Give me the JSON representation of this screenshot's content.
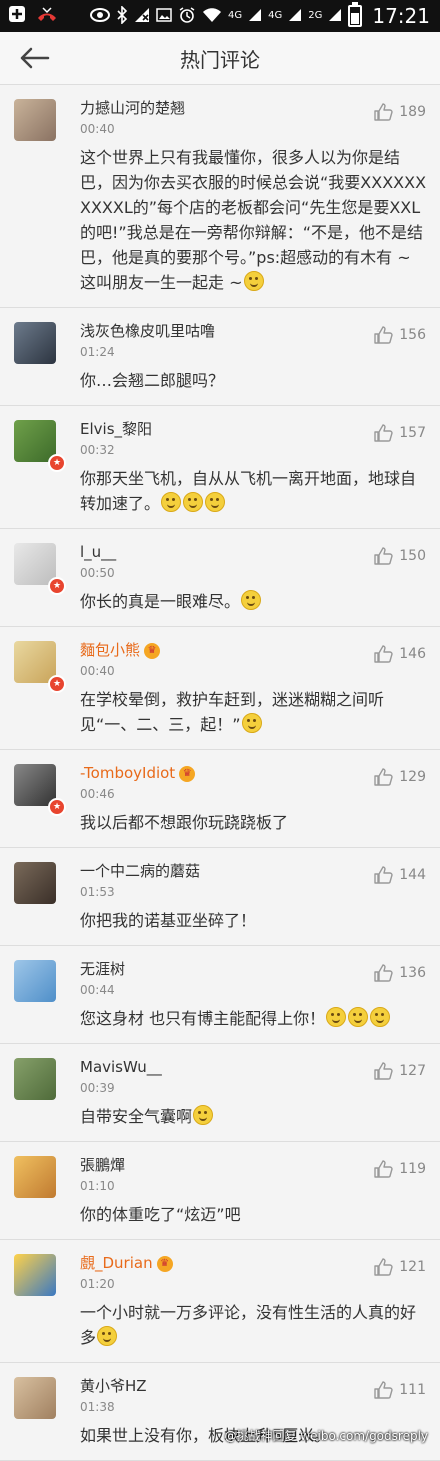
{
  "status_bar": {
    "network1": "4G",
    "network2": "4G",
    "network3": "2G",
    "time": "17:21"
  },
  "header": {
    "title": "热门评论"
  },
  "comments": [
    {
      "name": "力撼山河的楚翘",
      "time": "00:40",
      "likes": "189",
      "text": "这个世界上只有我最懂你，很多人以为你是结巴，因为你去买衣服的时候总会说“我要XXXXXXXXXXL的”每个店的老板都会问“先生您是要XXL的吧!”我总是在一旁帮你辩解：“不是，他不是结巴，他是真的要那个号。”ps:超感动的有木有 ~ 这叫朋友一生一起走 ~",
      "emojis": 1
    },
    {
      "name": "浅灰色橡皮叽里咕噜",
      "time": "01:24",
      "likes": "156",
      "text": "你…会翘二郎腿吗？",
      "emojis": 0
    },
    {
      "name": "Elvis_黎阳",
      "time": "00:32",
      "likes": "157",
      "text": "你那天坐飞机，自从从飞机一离开地面，地球自转加速了。",
      "emojis": 3
    },
    {
      "name": "l_u__",
      "time": "00:50",
      "likes": "150",
      "text": "你长的真是一眼难尽。",
      "emojis": 1
    },
    {
      "name": "麵包小熊",
      "time": "00:40",
      "likes": "146",
      "text": "在学校晕倒，救护车赶到，迷迷糊糊之间听见“一、二、三，起！”",
      "emojis": 1
    },
    {
      "name": "-TomboyIdiot",
      "time": "00:46",
      "likes": "129",
      "text": "我以后都不想跟你玩跷跷板了",
      "emojis": 0
    },
    {
      "name": "一个中二病的蘑菇",
      "time": "01:53",
      "likes": "144",
      "text": "你把我的诺基亚坐碎了！",
      "emojis": 0
    },
    {
      "name": "无涯树",
      "time": "00:44",
      "likes": "136",
      "text": "您这身材 也只有博主能配得上你！",
      "emojis": 3
    },
    {
      "name": "MavisWu__",
      "time": "00:39",
      "likes": "127",
      "text": "自带安全气囊啊",
      "emojis": 1
    },
    {
      "name": "張鵬燀",
      "time": "01:10",
      "likes": "119",
      "text": "你的体重吃了“炫迈”吧",
      "emojis": 0
    },
    {
      "name": "覻_Durian",
      "time": "01:20",
      "likes": "121",
      "text": "一个小时就一万多评论，没有性生活的人真的好多",
      "emojis": 1
    },
    {
      "name": "黄小爷HZ",
      "time": "01:38",
      "likes": "111",
      "text": "如果世上没有你，板块上升5厘米。",
      "emojis": 0
    }
  ],
  "watermark": "@挑战神回复 weibo.com/godsreply",
  "colors": {
    "vip_name": "#e86a1a",
    "badge": "#e8452f",
    "emoji": "#f4cf3c"
  }
}
